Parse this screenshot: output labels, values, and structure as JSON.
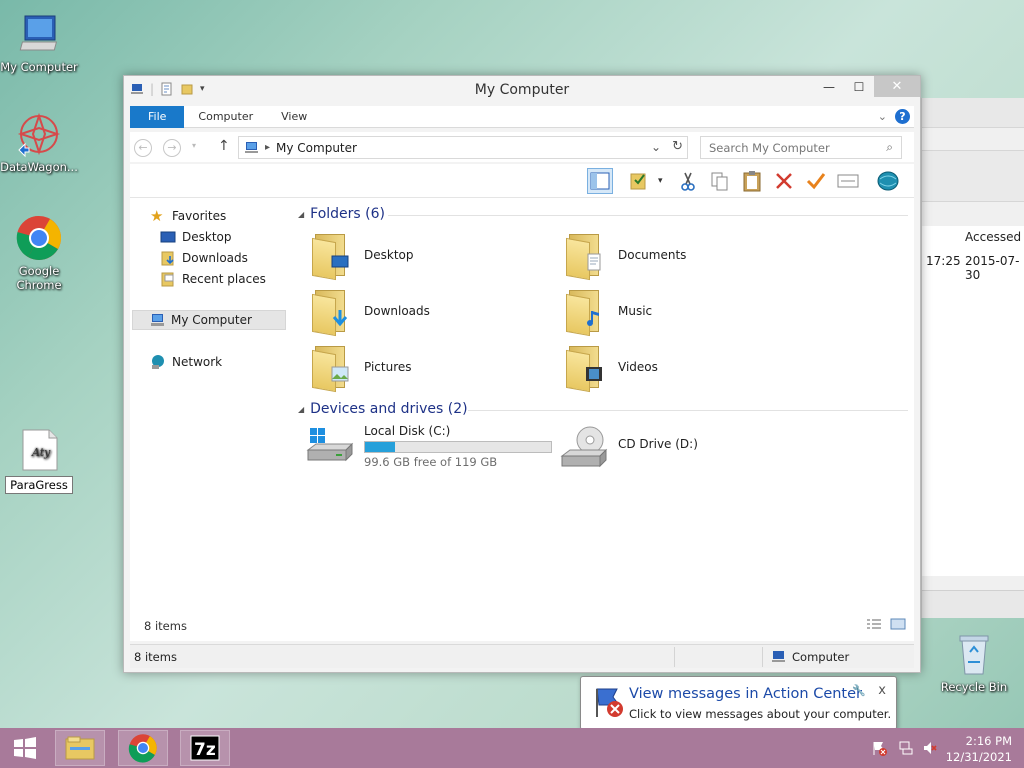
{
  "desktop": {
    "icons": [
      {
        "label": "My Computer"
      },
      {
        "label": "DataWagon..."
      },
      {
        "label": "Google Chrome"
      },
      {
        "label": "ParaGress"
      },
      {
        "label": "Recycle Bin"
      }
    ]
  },
  "background_window": {
    "header": "Accessed",
    "row_time": "17:25",
    "row_date": "2015-07-30"
  },
  "window": {
    "title": "My Computer",
    "controls": {
      "minimize": "—",
      "maximize": "☐",
      "close": "✕"
    },
    "ribbon_tabs": [
      "File",
      "Computer",
      "View"
    ],
    "address_path": "My Computer",
    "search_placeholder": "Search My Computer",
    "nav": {
      "favorites": "Favorites",
      "desktop": "Desktop",
      "downloads": "Downloads",
      "recent_places": "Recent places",
      "my_computer": "My Computer",
      "network": "Network"
    },
    "folders_group": "Folders (6)",
    "folders": [
      "Desktop",
      "Documents",
      "Downloads",
      "Music",
      "Pictures",
      "Videos"
    ],
    "devices_group": "Devices and drives (2)",
    "drives": [
      {
        "name": "Local Disk (C:)",
        "free_text": "99.6 GB free of 119 GB",
        "used_fraction": 0.163
      },
      {
        "name": "CD Drive (D:)"
      }
    ],
    "item_count_inner": "8 items",
    "status_left": "8 items",
    "status_right": "Computer"
  },
  "toast": {
    "title": "View messages in Action Center",
    "subtitle": "Click to view messages about your computer.",
    "close": "x"
  },
  "taskbar": {
    "time": "2:16 PM",
    "date": "12/31/2021"
  },
  "colors": {
    "accent": "#1979ca",
    "group_header": "#1e3287",
    "taskbar": "#a87a9a",
    "capacity_fill": "#26a0da"
  }
}
